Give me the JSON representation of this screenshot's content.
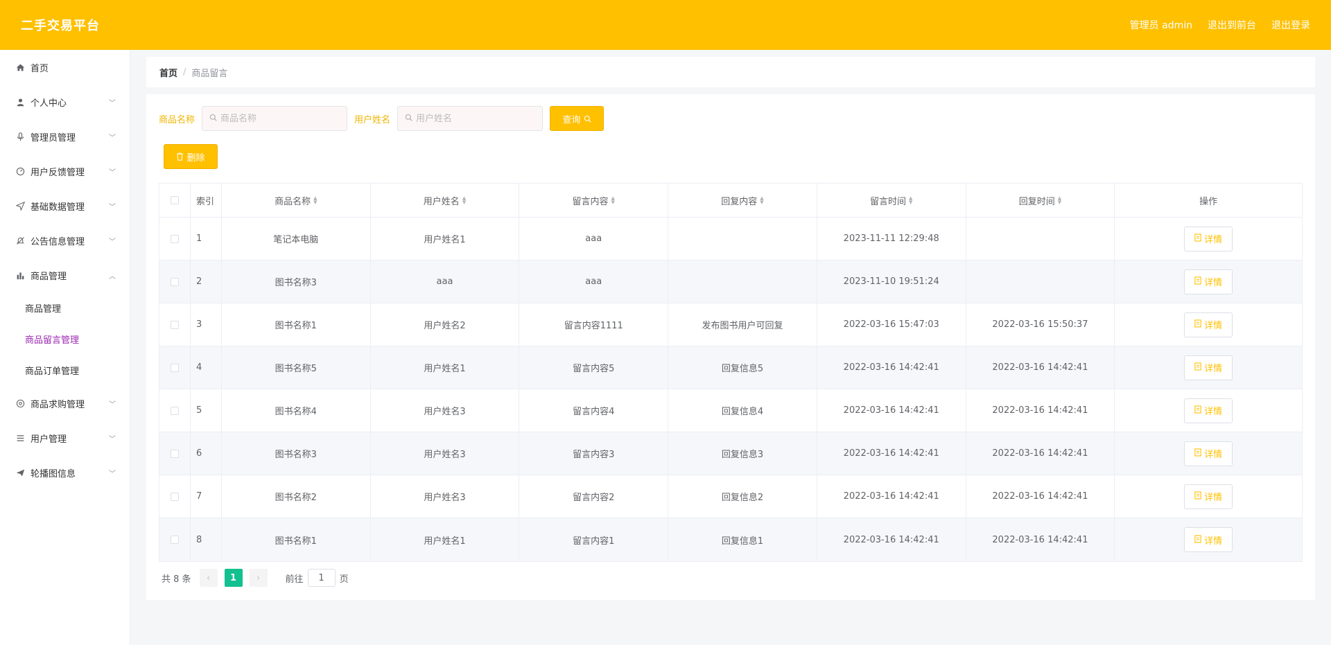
{
  "header": {
    "brand": "二手交易平台",
    "admin_label": "管理员 admin",
    "back_front": "退出到前台",
    "logout": "退出登录"
  },
  "sidebar": {
    "items": [
      {
        "label": "首页",
        "icon": "home-icon",
        "has_children": false
      },
      {
        "label": "个人中心",
        "icon": "user-icon",
        "has_children": true
      },
      {
        "label": "管理员管理",
        "icon": "microphone-icon",
        "has_children": true
      },
      {
        "label": "用户反馈管理",
        "icon": "gauge-icon",
        "has_children": true
      },
      {
        "label": "基础数据管理",
        "icon": "send-icon",
        "has_children": true
      },
      {
        "label": "公告信息管理",
        "icon": "bell-off-icon",
        "has_children": true
      },
      {
        "label": "商品管理",
        "icon": "bar-chart-icon",
        "has_children": true,
        "expanded": true
      }
    ],
    "sub_items": [
      {
        "label": "商品管理",
        "active": false
      },
      {
        "label": "商品留言管理",
        "active": true
      },
      {
        "label": "商品订单管理",
        "active": false
      }
    ],
    "items_after": [
      {
        "label": "商品求购管理",
        "icon": "aperture-icon",
        "has_children": true
      },
      {
        "label": "用户管理",
        "icon": "list-icon",
        "has_children": true
      },
      {
        "label": "轮播图信息",
        "icon": "paper-plane-icon",
        "has_children": true
      }
    ]
  },
  "breadcrumb": {
    "home": "首页",
    "separator": "/",
    "current": "商品留言"
  },
  "search": {
    "product_label": "商品名称",
    "product_placeholder": "商品名称",
    "user_label": "用户姓名",
    "user_placeholder": "用户姓名",
    "query_button": "查询"
  },
  "delete_button": "删除",
  "table": {
    "headers": [
      "索引",
      "商品名称",
      "用户姓名",
      "留言内容",
      "回复内容",
      "留言时间",
      "回复时间",
      "操作"
    ],
    "detail_label": "详情",
    "rows": [
      [
        "1",
        "笔记本电脑",
        "用户姓名1",
        "aaa",
        "",
        "2023-11-11 12:29:48",
        ""
      ],
      [
        "2",
        "图书名称3",
        "aaa",
        "aaa",
        "",
        "2023-11-10 19:51:24",
        ""
      ],
      [
        "3",
        "图书名称1",
        "用户姓名2",
        "留言内容1111",
        "发布图书用户可回复",
        "2022-03-16 15:47:03",
        "2022-03-16 15:50:37"
      ],
      [
        "4",
        "图书名称5",
        "用户姓名1",
        "留言内容5",
        "回复信息5",
        "2022-03-16 14:42:41",
        "2022-03-16 14:42:41"
      ],
      [
        "5",
        "图书名称4",
        "用户姓名3",
        "留言内容4",
        "回复信息4",
        "2022-03-16 14:42:41",
        "2022-03-16 14:42:41"
      ],
      [
        "6",
        "图书名称3",
        "用户姓名3",
        "留言内容3",
        "回复信息3",
        "2022-03-16 14:42:41",
        "2022-03-16 14:42:41"
      ],
      [
        "7",
        "图书名称2",
        "用户姓名3",
        "留言内容2",
        "回复信息2",
        "2022-03-16 14:42:41",
        "2022-03-16 14:42:41"
      ],
      [
        "8",
        "图书名称1",
        "用户姓名1",
        "留言内容1",
        "回复信息1",
        "2022-03-16 14:42:41",
        "2022-03-16 14:42:41"
      ]
    ]
  },
  "pagination": {
    "total": "共 8 条",
    "current_page": "1",
    "goto_label": "前往",
    "goto_value": "1",
    "page_suffix": "页"
  },
  "colors": {
    "accent": "#ffc000",
    "active_menu": "#9c27b0",
    "page_active": "#13c08f"
  }
}
